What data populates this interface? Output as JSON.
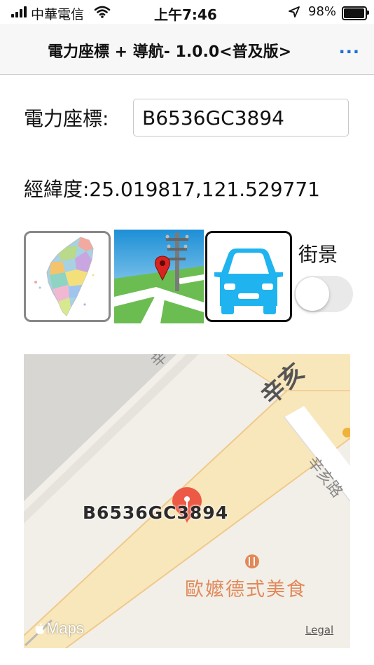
{
  "status_bar": {
    "carrier": "中華電信",
    "time": "上午7:46",
    "battery_text": "98%",
    "battery_level": 0.98
  },
  "navbar": {
    "title": "電力座標 + 導航- 1.0.0<普及版>",
    "more": "..."
  },
  "form": {
    "coord_label": "電力座標:",
    "coord_value": "B6536GC3894",
    "latlng_text": "經緯度:25.019817,121.529771"
  },
  "buttons": {
    "taiwan_map_icon": "taiwan-map-icon",
    "street_pole_icon": "utility-pole-map-icon",
    "car_icon": "car-icon"
  },
  "street_view": {
    "label": "街景",
    "enabled": false
  },
  "map": {
    "pin_label": "B6536GC3894",
    "poi_label": "歐嬤德式美食",
    "road_label_1": "辛亥",
    "road_label_2": "辛亥路",
    "maps_logo": "Maps",
    "legal": "Legal",
    "colors": {
      "land": "#f2efe8",
      "road": "#f8e7bb",
      "road_edge": "#f0c98a",
      "pin": "#ec5a45",
      "poi": "#e1895a"
    }
  }
}
